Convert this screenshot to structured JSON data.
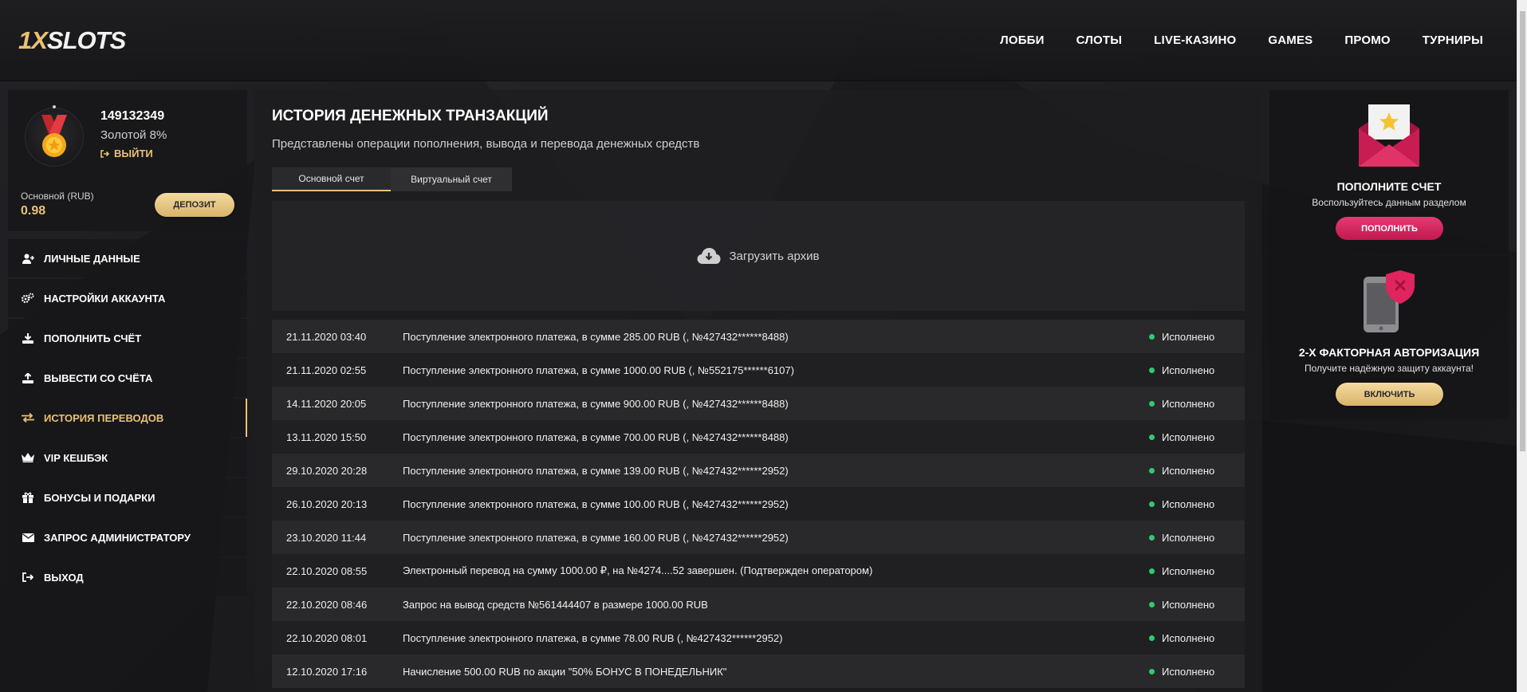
{
  "header": {
    "logo_prefix": "1X",
    "logo_suffix": "SLOTS",
    "nav": [
      "ЛОББИ",
      "СЛОТЫ",
      "LIVE-КАЗИНО",
      "GAMES",
      "ПРОМО",
      "ТУРНИРЫ"
    ]
  },
  "profile": {
    "user_id": "149132349",
    "level": "Золотой 8%",
    "logout_label": "ВЫЙТИ",
    "account_label": "Основной (RUB)",
    "balance": "0.98",
    "deposit_label": "ДЕПОЗИТ"
  },
  "sidebar": {
    "items": [
      {
        "label": "ЛИЧНЫЕ ДАННЫЕ",
        "icon": "user-plus-icon"
      },
      {
        "label": "НАСТРОЙКИ АККАУНТА",
        "icon": "gears-icon"
      },
      {
        "label": "ПОПОЛНИТЬ СЧЁТ",
        "icon": "download-icon"
      },
      {
        "label": "ВЫВЕСТИ СО СЧЁТА",
        "icon": "upload-icon"
      },
      {
        "label": "ИСТОРИЯ ПЕРЕВОДОВ",
        "icon": "transfer-arrows-icon",
        "active": true
      },
      {
        "label": "VIP КЕШБЭК",
        "icon": "crown-icon"
      },
      {
        "label": "БОНУСЫ И ПОДАРКИ",
        "icon": "gift-icon"
      },
      {
        "label": "ЗАПРОС АДМИНИСТРАТОРУ",
        "icon": "envelope-icon"
      },
      {
        "label": "ВЫХОД",
        "icon": "sign-out-icon"
      }
    ]
  },
  "main": {
    "title": "ИСТОРИЯ ДЕНЕЖНЫХ ТРАНЗАКЦИЙ",
    "subtitle": "Представлены операции пополнения, вывода и перевода денежных средств",
    "tabs": [
      "Основной счет",
      "Виртуальный счет"
    ],
    "archive_label": "Загрузить архив",
    "transactions": [
      {
        "date": "21.11.2020 03:40",
        "desc": "Поступление электронного платежа, в сумме 285.00 RUB (, №427432******8488)",
        "status": "Исполнено"
      },
      {
        "date": "21.11.2020 02:55",
        "desc": "Поступление электронного платежа, в сумме 1000.00 RUB (, №552175******6107)",
        "status": "Исполнено"
      },
      {
        "date": "14.11.2020 20:05",
        "desc": "Поступление электронного платежа, в сумме 900.00 RUB (, №427432******8488)",
        "status": "Исполнено"
      },
      {
        "date": "13.11.2020 15:50",
        "desc": "Поступление электронного платежа, в сумме 700.00 RUB (, №427432******8488)",
        "status": "Исполнено"
      },
      {
        "date": "29.10.2020 20:28",
        "desc": "Поступление электронного платежа, в сумме 139.00 RUB (, №427432******2952)",
        "status": "Исполнено"
      },
      {
        "date": "26.10.2020 20:13",
        "desc": "Поступление электронного платежа, в сумме 100.00 RUB (, №427432******2952)",
        "status": "Исполнено"
      },
      {
        "date": "23.10.2020 11:44",
        "desc": "Поступление электронного платежа, в сумме 160.00 RUB (, №427432******2952)",
        "status": "Исполнено"
      },
      {
        "date": "22.10.2020 08:55",
        "desc": "Электронный перевод на сумму 1000.00 ₽, на №4274....52 завершен. (Подтвержден оператором)",
        "status": "Исполнено"
      },
      {
        "date": "22.10.2020 08:46",
        "desc": "Запрос на вывод средств №561444407 в размере 1000.00 RUB",
        "status": "Исполнено"
      },
      {
        "date": "22.10.2020 08:01",
        "desc": "Поступление электронного платежа, в сумме 78.00 RUB (, №427432******2952)",
        "status": "Исполнено"
      },
      {
        "date": "12.10.2020 17:16",
        "desc": "Начисление 500.00 RUB по акции \"50% БОНУС В ПОНЕДЕЛЬНИК\"",
        "status": "Исполнено"
      }
    ]
  },
  "widgets": {
    "deposit": {
      "title": "ПОПОЛНИТЕ СЧЕТ",
      "text": "Воспользуйтесь данным разделом",
      "button": "ПОПОЛНИТЬ",
      "icon": "envelope-star-icon"
    },
    "twofa": {
      "title": "2-Х ФАКТОРНАЯ АВТОРИЗАЦИЯ",
      "text": "Получите надёжную защиту аккаунта!",
      "button": "ВКЛЮЧИТЬ",
      "icon": "phone-shield-icon"
    }
  },
  "colors": {
    "accent_gold": "#e9c272",
    "accent_pink": "#d12a62",
    "status_green": "#2ecc71"
  }
}
